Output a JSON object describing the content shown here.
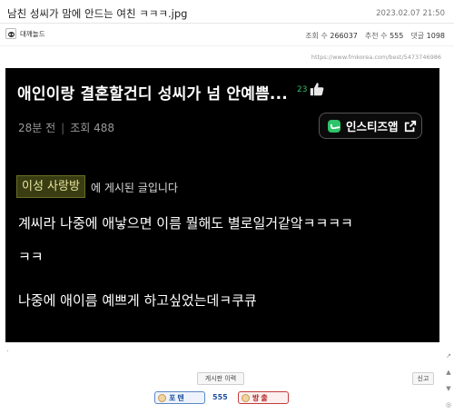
{
  "post": {
    "title": "남친 성씨가 맘에 안드는 여친 ㅋㅋㅋ.jpg",
    "date": "2023.02.07 21:50",
    "author": "대깨놀드",
    "views_label": "조회 수",
    "views": "266037",
    "recommend_label": "추천 수",
    "recommend": "555",
    "comments_label": "댓글",
    "comments": "1098",
    "source_url": "https://www.fmkorea.com/best/5473746986"
  },
  "screenshot": {
    "title": "애인이랑 결혼할건디 성씨가 넘 안예쁨...",
    "like_count": "23",
    "time_ago": "28분 전",
    "views": "조회 488",
    "app_button": "인스티즈앱",
    "board_name": "이성 사랑방",
    "board_suffix": "에 게시된 글입니다",
    "line1": "계씨라 나중에 애낳으면 이름 뭘해도 별로일거같앜ㅋㅋㅋㅋ",
    "line2": "ㅋㅋ",
    "line3": "나중에 애이름 예쁘게 하고싶었는데ㅋ쿠큐"
  },
  "footer": {
    "dot": ".",
    "history_button": "게시판 이력",
    "report_button": "신고",
    "upvote_label": "포텐",
    "vote_count": "555",
    "downvote_label": "방출"
  },
  "icons": {
    "like": "thumbs-up-icon",
    "external": "external-link-icon",
    "app": "instiz-logo-icon",
    "avatar": "panda-avatar-icon"
  },
  "colors": {
    "card_bg": "#000000",
    "like_green": "#2fbf71",
    "board_tag_bg": "#3a3d12",
    "upvote_blue": "#1f4f9e",
    "downvote_red": "#b42020"
  }
}
